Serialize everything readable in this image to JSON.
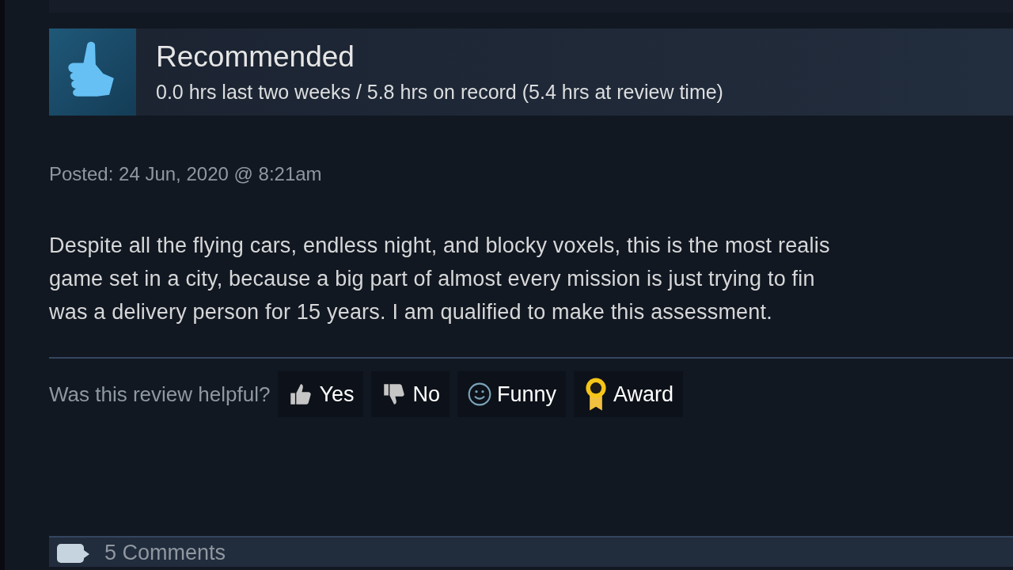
{
  "review": {
    "verdict": "Recommended",
    "hours": "0.0 hrs last two weeks / 5.8 hrs on record (5.4 hrs at review time)",
    "posted": "Posted: 24 Jun, 2020 @ 8:21am",
    "text_lines": [
      "Despite all the flying cars, endless night, and blocky voxels, this is the most realis",
      "game set in a city, because a big part of almost every mission is just trying to fin",
      "was a delivery person for 15 years. I am qualified to make this assessment."
    ]
  },
  "helpful": {
    "prompt": "Was this review helpful?",
    "buttons": [
      {
        "kind": "yes",
        "label": "Yes"
      },
      {
        "kind": "no",
        "label": "No"
      },
      {
        "kind": "funny",
        "label": "Funny"
      },
      {
        "kind": "award",
        "label": "Award"
      }
    ]
  },
  "comments": {
    "label": "5 Comments"
  }
}
